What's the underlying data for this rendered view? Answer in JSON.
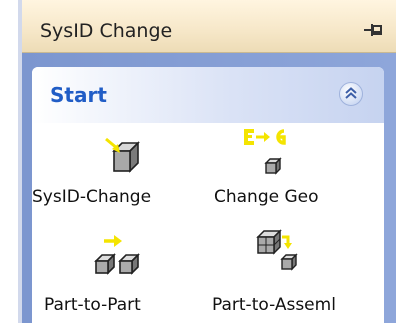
{
  "panel": {
    "title": "SysID Change",
    "pin_icon": "pin-icon"
  },
  "group": {
    "title": "Start",
    "collapse_icon": "chevron-double-up-icon"
  },
  "tools": [
    {
      "label": "SysID-Change",
      "icon": "cube-with-arrow-icon"
    },
    {
      "label": "Change Geo",
      "icon": "geometry-change-icon"
    },
    {
      "label": "Part-to-Part",
      "icon": "part-to-part-icon"
    },
    {
      "label": "Part-to-Asseml",
      "icon": "part-to-assembly-icon"
    }
  ],
  "colors": {
    "accent": "#215dc6",
    "task_pane_blue": "#8ea6da",
    "header_tan": "#f6e7c8",
    "icon_yellow": "#f4e400"
  }
}
